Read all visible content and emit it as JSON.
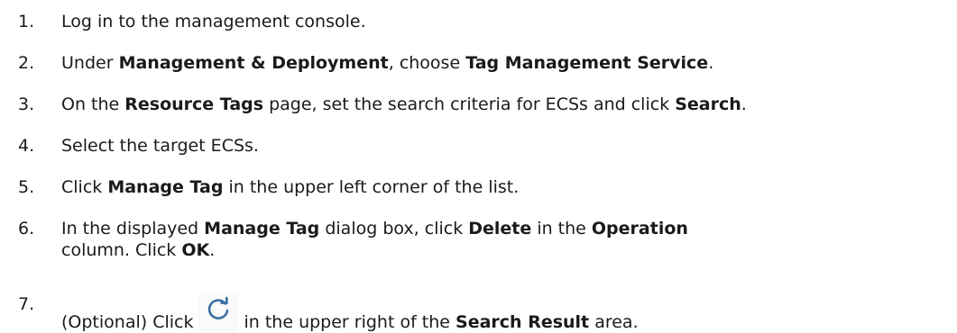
{
  "steps": [
    {
      "num": "1.",
      "parts": [
        "Log in to the management console."
      ]
    },
    {
      "num": "2.",
      "parts": [
        "Under ",
        "Management & Deployment",
        ", choose ",
        "Tag Management Service",
        "."
      ]
    },
    {
      "num": "3.",
      "parts": [
        "On the ",
        "Resource Tags",
        " page, set the search criteria for ECSs and click ",
        "Search",
        "."
      ]
    },
    {
      "num": "4.",
      "parts": [
        "Select the target ECSs."
      ]
    },
    {
      "num": "5.",
      "parts": [
        "Click ",
        "Manage Tag",
        " in the upper left corner of the list."
      ]
    },
    {
      "num": "6.",
      "parts": [
        "In the displayed ",
        "Manage Tag",
        " dialog box, click ",
        "Delete",
        " in the ",
        "Operation"
      ],
      "line2": [
        "column. Click ",
        "OK",
        "."
      ]
    },
    {
      "num": "7.",
      "parts": [
        "(Optional) Click",
        "in the upper right of the ",
        "Search Result",
        " area."
      ]
    }
  ],
  "icons": {
    "refresh": "refresh-icon",
    "refresh_color": "#3a6ea5"
  }
}
